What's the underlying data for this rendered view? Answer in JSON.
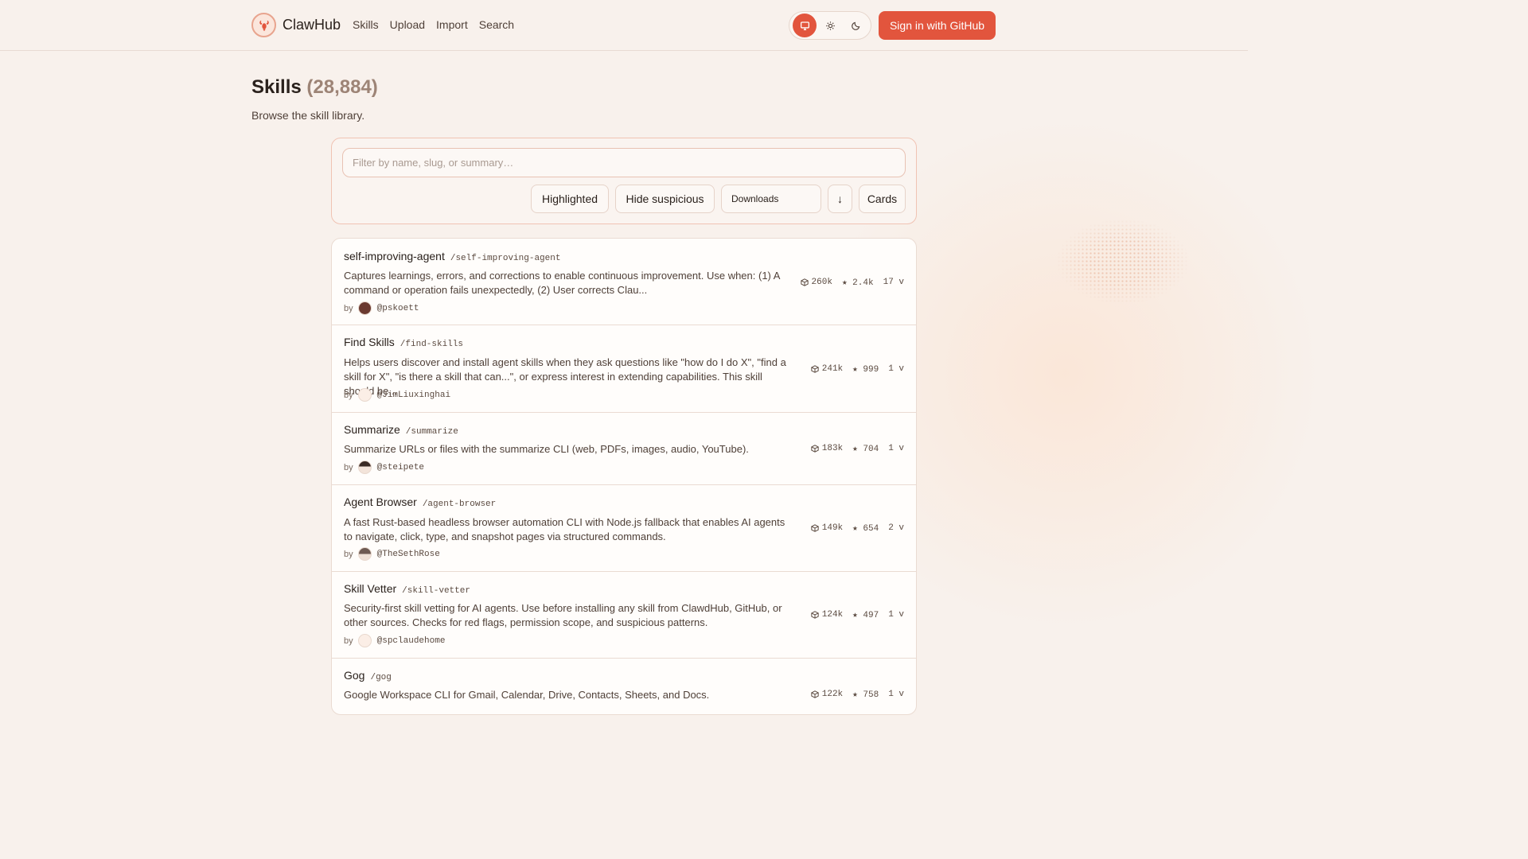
{
  "header": {
    "brand": "ClawHub",
    "nav": [
      "Skills",
      "Upload",
      "Import",
      "Search"
    ],
    "theme_modes": [
      "monitor-icon",
      "sun-icon",
      "moon-icon"
    ],
    "active_theme": "monitor-icon",
    "signin_label": "Sign in  with GitHub"
  },
  "page": {
    "title": "Skills",
    "count": "(28,884)",
    "subtitle": "Browse the skill library."
  },
  "filters": {
    "placeholder": "Filter by name, slug, or summary…",
    "highlighted": "Highlighted",
    "hide_suspicious": "Hide suspicious",
    "sort": "Downloads",
    "direction": "↓",
    "view": "Cards"
  },
  "skills": [
    {
      "name": "self-improving-agent",
      "slug": "/self-improving-agent",
      "summary": "Captures learnings, errors, and corrections to enable continuous improvement. Use when: (1) A command or operation fails unexpectedly, (2) User corrects Clau...",
      "by": "by",
      "author": "@pskoett",
      "downloads": "260k",
      "stars": "★ 2.4k",
      "versions": "17 v"
    },
    {
      "name": "Find Skills",
      "slug": "/find-skills",
      "summary": "Helps users discover and install agent skills when they ask questions like \"how do I do X\", \"find a skill for X\", \"is there a skill that can...\", or express interest in extending capabilities. This skill should be...",
      "by": "by",
      "author": "@JimLiuxinghai",
      "downloads": "241k",
      "stars": "★ 999",
      "versions": "1 v"
    },
    {
      "name": "Summarize",
      "slug": "/summarize",
      "summary": "Summarize URLs or files with the summarize CLI (web, PDFs, images, audio, YouTube).",
      "by": "by",
      "author": "@steipete",
      "downloads": "183k",
      "stars": "★ 704",
      "versions": "1 v"
    },
    {
      "name": "Agent Browser",
      "slug": "/agent-browser",
      "summary": "A fast Rust-based headless browser automation CLI with Node.js fallback that enables AI agents to navigate, click, type, and snapshot pages via structured commands.",
      "by": "by",
      "author": "@TheSethRose",
      "downloads": "149k",
      "stars": "★ 654",
      "versions": "2 v"
    },
    {
      "name": "Skill Vetter",
      "slug": "/skill-vetter",
      "summary": "Security-first skill vetting for AI agents. Use before installing any skill from ClawdHub, GitHub, or other sources. Checks for red flags, permission scope, and suspicious patterns.",
      "by": "by",
      "author": "@spclaudehome",
      "downloads": "124k",
      "stars": "★ 497",
      "versions": "1 v"
    },
    {
      "name": "Gog",
      "slug": "/gog",
      "summary": "Google Workspace CLI for Gmail, Calendar, Drive, Contacts, Sheets, and Docs.",
      "by": "by",
      "author": "",
      "downloads": "122k",
      "stars": "★ 758",
      "versions": "1 v"
    }
  ],
  "colors": {
    "accent": "#e2553d",
    "background": "#f8f1ec",
    "border": "#eadbd2"
  }
}
